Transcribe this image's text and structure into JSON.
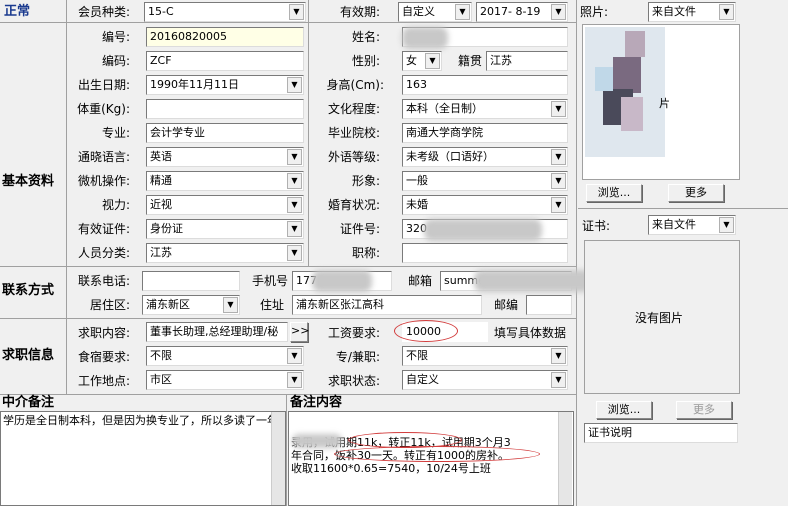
{
  "sections": {
    "normal": "正常",
    "basic": "基本资料",
    "contact": "联系方式",
    "job": "求职信息",
    "agent_note": "中介备注",
    "remark": "备注内容"
  },
  "fields": {
    "member_type": {
      "label": "会员种类:",
      "value": "15-C"
    },
    "validity": {
      "label": "有效期:",
      "value": "自定义",
      "date": "2017- 8-19"
    },
    "photo": {
      "label": "照片:",
      "value": "来自文件"
    },
    "number": {
      "label": "编号:",
      "value": "20160820005"
    },
    "name": {
      "label": "姓名:",
      "value": ""
    },
    "code": {
      "label": "编码:",
      "value": "ZCF"
    },
    "gender": {
      "label": "性别:",
      "value": "女"
    },
    "native": {
      "label": "籍贯",
      "value": "江苏"
    },
    "birth": {
      "label": "出生日期:",
      "value": "1990年11月11日"
    },
    "height": {
      "label": "身高(Cm):",
      "value": "163"
    },
    "weight": {
      "label": "体重(Kg):",
      "value": ""
    },
    "education": {
      "label": "文化程度:",
      "value": "本科（全日制）"
    },
    "major": {
      "label": "专业:",
      "value": "会计学专业"
    },
    "school": {
      "label": "毕业院校:",
      "value": "南通大学商学院"
    },
    "language": {
      "label": "通晓语言:",
      "value": "英语"
    },
    "foreign_level": {
      "label": "外语等级:",
      "value": "未考级（口语好）"
    },
    "computer": {
      "label": "微机操作:",
      "value": "精通"
    },
    "appearance": {
      "label": "形象:",
      "value": "一般"
    },
    "vision": {
      "label": "视力:",
      "value": "近视"
    },
    "marriage": {
      "label": "婚育状况:",
      "value": "未婚"
    },
    "id_type": {
      "label": "有效证件:",
      "value": "身份证"
    },
    "id_no": {
      "label": "证件号:",
      "value": "320"
    },
    "category": {
      "label": "人员分类:",
      "value": "江苏"
    },
    "title": {
      "label": "职称:",
      "value": ""
    },
    "phone": {
      "label": "联系电话:",
      "value": ""
    },
    "mobile": {
      "label": "手机号",
      "value": "177"
    },
    "email": {
      "label": "邮箱",
      "value": "summe"
    },
    "district": {
      "label": "居住区:",
      "value": "浦东新区"
    },
    "address": {
      "label": "住址",
      "value": "浦东新区张江高科"
    },
    "postcode": {
      "label": "邮编",
      "value": ""
    },
    "job_wanted": {
      "label": "求职内容:",
      "value": "董事长助理,总经理助理/秘",
      "more": ">>"
    },
    "salary": {
      "label": "工资要求:",
      "value": "10000",
      "hint": "填写具体数据"
    },
    "board": {
      "label": "食宿要求:",
      "value": "不限"
    },
    "fulltime": {
      "label": "专/兼职:",
      "value": "不限"
    },
    "work_place": {
      "label": "工作地点:",
      "value": "市区"
    },
    "job_status": {
      "label": "求职状态:",
      "value": "自定义"
    },
    "certificate": {
      "label": "证书:",
      "value": "来自文件"
    }
  },
  "photo_panel": {
    "placeholder": "片",
    "browse": "浏览...",
    "more": "更多"
  },
  "cert_panel": {
    "placeholder": "没有图片",
    "browse": "浏览...",
    "more": "更多",
    "desc": "证书说明"
  },
  "agent_note_text": "学历是全日制本科，但是因为换专业了，所以多读了一年",
  "remark_text": [
    "录用，试用期11k，转正11k，试用期3个月3",
    "年合同，饭补30一天。转正有1000的房补。",
    "收取11600*0.65=7540，10/24号上班"
  ]
}
